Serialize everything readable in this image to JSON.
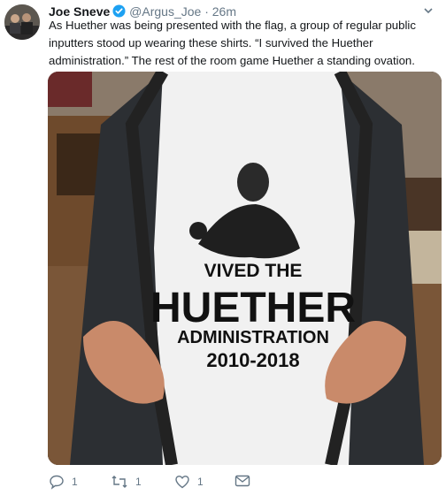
{
  "tweet": {
    "author_name": "Joe Sneve",
    "handle": "@Argus_Joe",
    "separator": "·",
    "time": "26m",
    "text": "As Huether was being presented with the flag, a group of regular public inputters stood up wearing these shirts. “I survived the Huether administration.” The rest of the room game Huether a standing ovation."
  },
  "photo": {
    "shirt_line1": "VIVED THE",
    "shirt_line2": "HUETHER",
    "shirt_line3": "ADMINISTRATION",
    "shirt_line4": "2010-2018"
  },
  "actions": {
    "reply_count": "1",
    "retweet_count": "1",
    "like_count": "1"
  },
  "colors": {
    "verified": "#1da1f2",
    "secondary_text": "#657786"
  }
}
